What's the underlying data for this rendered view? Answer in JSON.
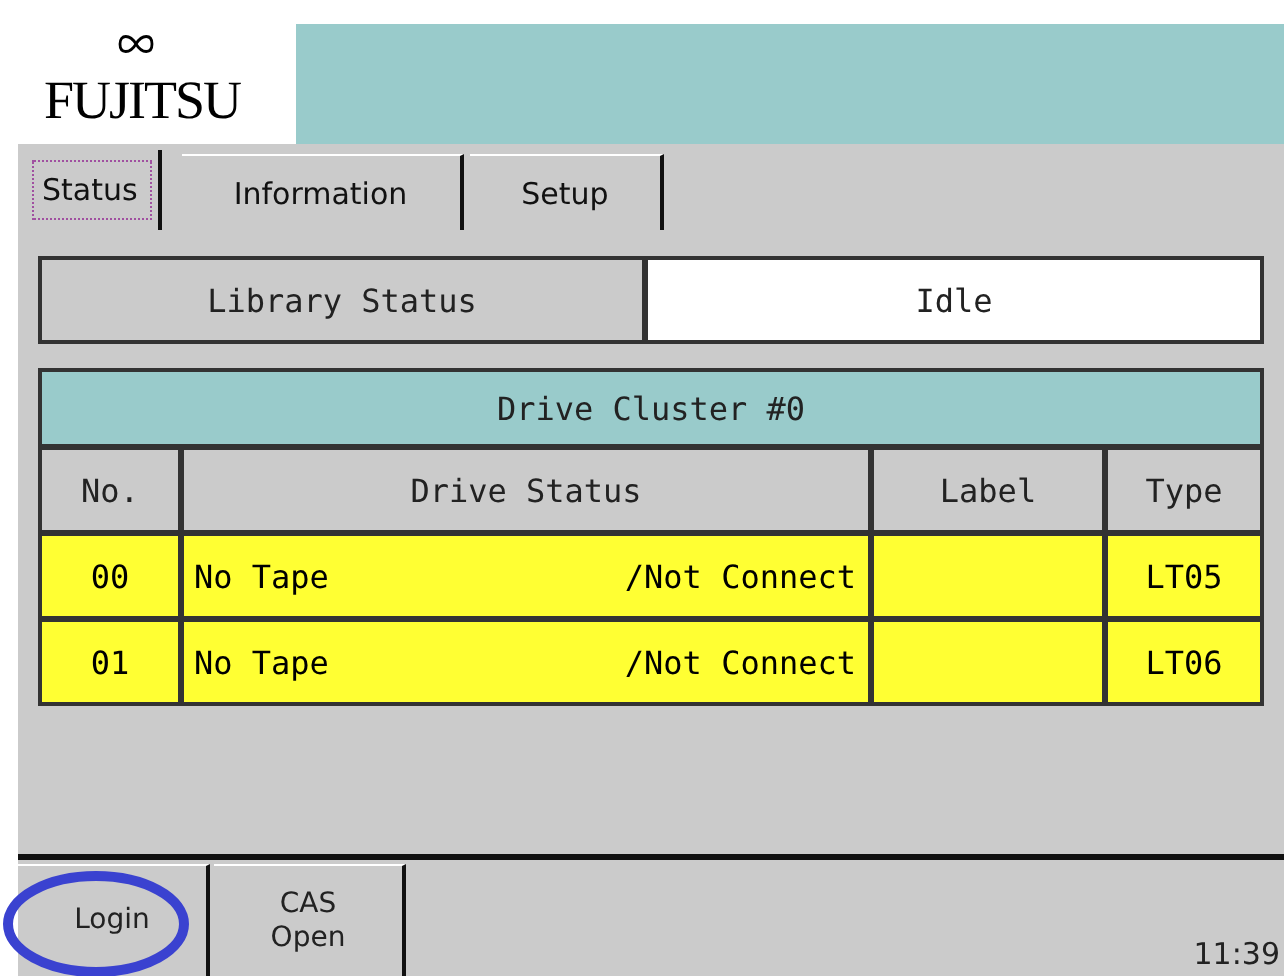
{
  "header": {
    "logo": "FUJITSU"
  },
  "tabs": [
    {
      "label": "Status",
      "selected": true
    },
    {
      "label": "Information",
      "selected": false
    },
    {
      "label": "Setup",
      "selected": false
    }
  ],
  "library_status": {
    "label": "Library Status",
    "value": "Idle"
  },
  "drive_cluster": {
    "title": "Drive Cluster #0",
    "columns": [
      "No.",
      "Drive Status",
      "Label",
      "Type"
    ],
    "rows": [
      {
        "no": "00",
        "tape": "No Tape",
        "connection": "/Not Connect",
        "label": "",
        "type": "LT05"
      },
      {
        "no": "01",
        "tape": "No Tape",
        "connection": "/Not Connect",
        "label": "",
        "type": "LT06"
      }
    ]
  },
  "bottom_buttons": [
    {
      "label": "Login",
      "highlighted": true
    },
    {
      "label": "CAS Open",
      "highlighted": false
    }
  ],
  "clock": "11:39"
}
